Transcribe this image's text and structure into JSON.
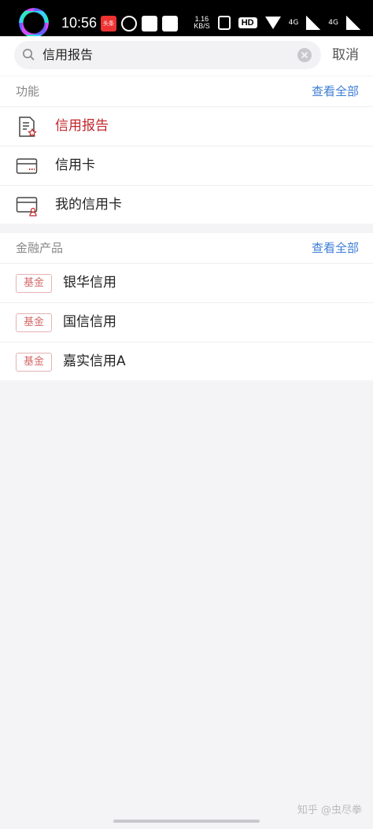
{
  "status_bar": {
    "time": "10:56",
    "app_badge": "头条",
    "speed_value": "1.16",
    "speed_unit": "KB/S",
    "hd": "HD",
    "net1": "4G",
    "net2": "4G"
  },
  "search": {
    "query": "信用报告",
    "cancel_label": "取消"
  },
  "functions": {
    "title": "功能",
    "more_label": "查看全部",
    "items": [
      {
        "label": "信用报告",
        "icon": "credit-report-icon"
      },
      {
        "label": "信用卡",
        "icon": "credit-card-icon"
      },
      {
        "label": "我的信用卡",
        "icon": "my-credit-card-icon"
      }
    ]
  },
  "products": {
    "title": "金融产品",
    "more_label": "查看全部",
    "items": [
      {
        "tag": "基金",
        "label": "银华信用"
      },
      {
        "tag": "基金",
        "label": "国信信用"
      },
      {
        "tag": "基金",
        "label": "嘉实信用A"
      }
    ]
  },
  "watermark": "知乎 @虫尽拳",
  "colors": {
    "accent_red": "#c1272d",
    "link_blue": "#3d7ed6",
    "tag_red": "#d46a6a"
  }
}
